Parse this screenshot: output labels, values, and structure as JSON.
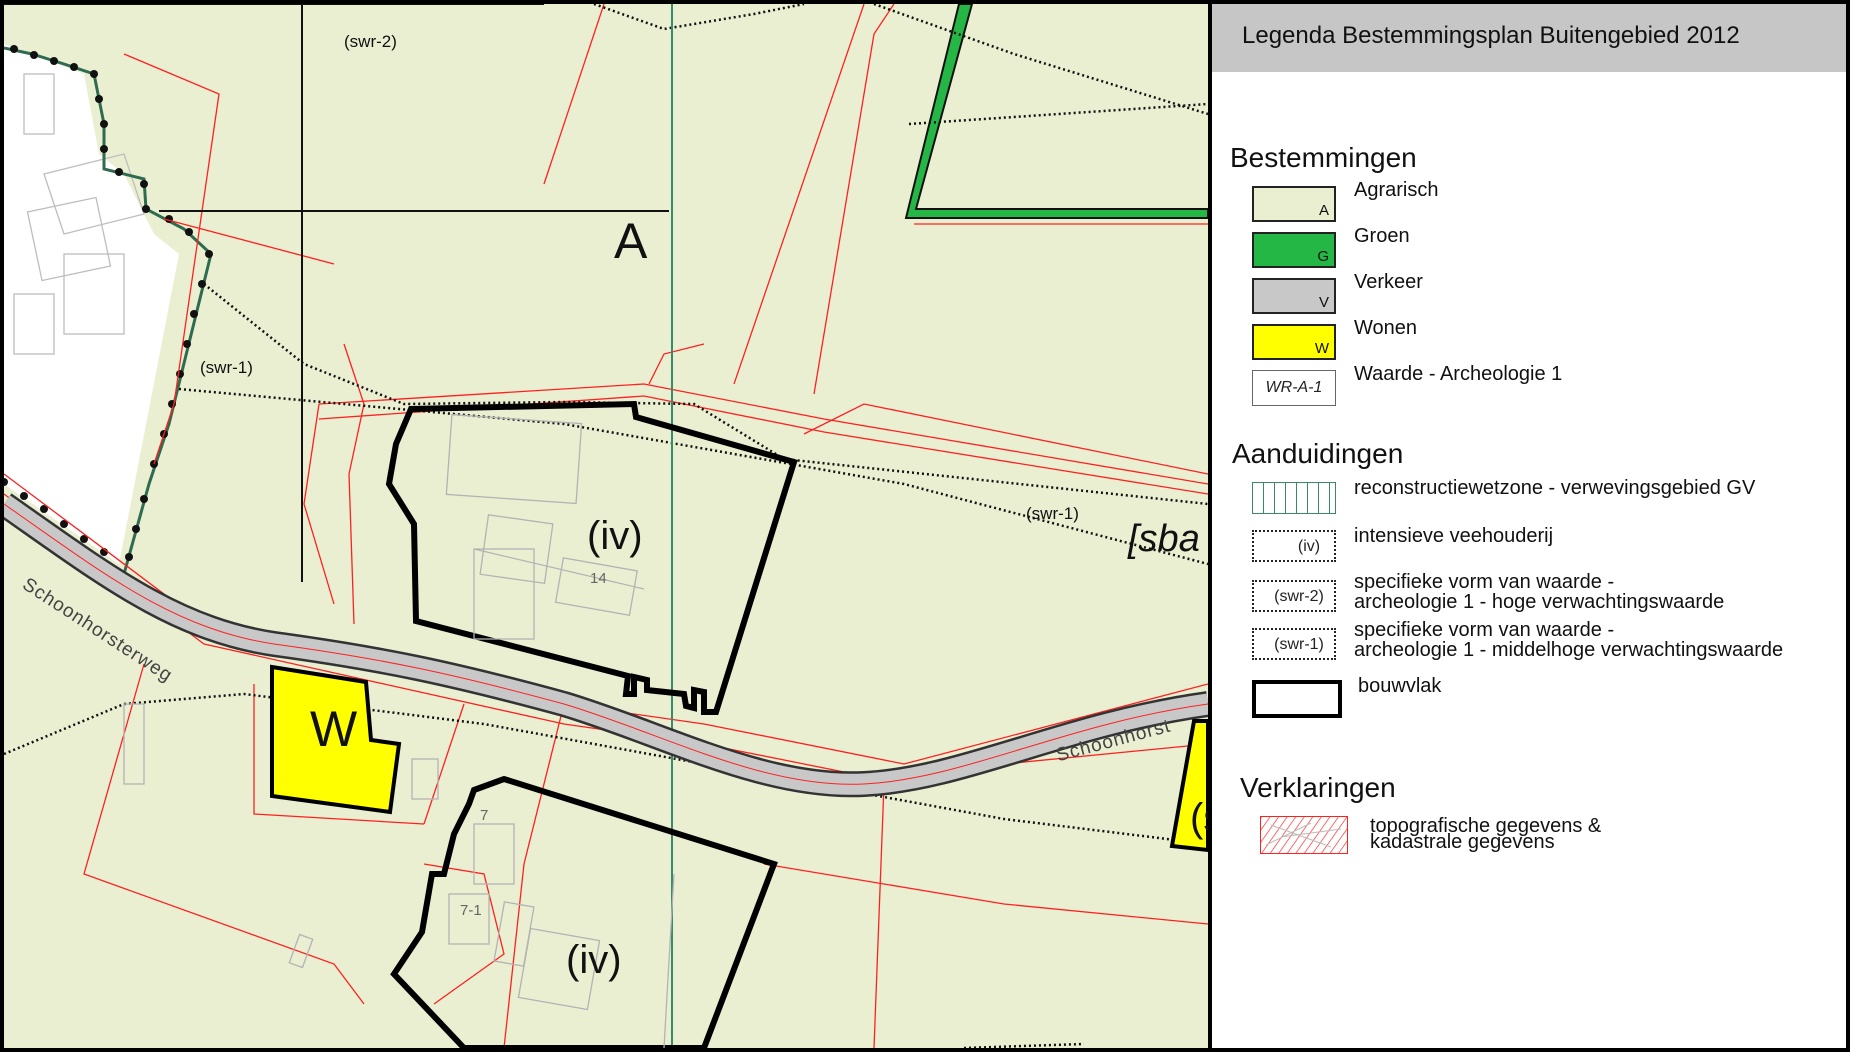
{
  "map": {
    "labels": {
      "swr2": "(swr-2)",
      "swr1_left": "(swr-1)",
      "swr1_right": "(swr-1)",
      "bestemming_a": "A",
      "iv_top": "(iv)",
      "iv_bottom": "(iv)",
      "house_14": "14",
      "house_7": "7",
      "house_7_1": "7-1",
      "wonen_w": "W",
      "road_left": "Schoonhorsterweg",
      "road_right": "Schoonhorst",
      "sba": "[sba",
      "wonen_right": "(s"
    }
  },
  "legend": {
    "title": "Legenda Bestemmingsplan Buitengebied 2012",
    "bestemmingen_title": "Bestemmingen",
    "bestemmingen": [
      {
        "code": "A",
        "label": "Agrarisch",
        "color": "#eaefd2"
      },
      {
        "code": "G",
        "label": "Groen",
        "color": "#25b745"
      },
      {
        "code": "V",
        "label": "Verkeer",
        "color": "#c8c8c8"
      },
      {
        "code": "W",
        "label": "Wonen",
        "color": "#ffff00"
      },
      {
        "code": "WR-A-1",
        "label": "Waarde - Archeologie 1",
        "color": "#ffffff"
      }
    ],
    "aanduidingen_title": "Aanduidingen",
    "aanduidingen": [
      {
        "code": "",
        "label": "reconstructiewetzone - verwevingsgebied GV"
      },
      {
        "code": "(iv)",
        "label": "intensieve veehouderij"
      },
      {
        "code": "(swr-2)",
        "label": "specifieke vorm van waarde -",
        "label2": "archeologie 1 - hoge verwachtingswaarde"
      },
      {
        "code": "(swr-1)",
        "label": "specifieke vorm van waarde -",
        "label2": "archeologie 1 - middelhoge verwachtingswaarde"
      },
      {
        "code": "",
        "label": "bouwvlak"
      }
    ],
    "verklaringen_title": "Verklaringen",
    "verklaringen": [
      {
        "label": "topografische gegevens &",
        "label2": "kadastrale gegevens"
      }
    ]
  },
  "colors": {
    "agrarisch": "#eaefd2",
    "groen": "#25b745",
    "verkeer": "#c8c8c8",
    "wonen": "#ffff00",
    "kadaster": "#ff2020",
    "zone_line": "#3a8a6a"
  }
}
